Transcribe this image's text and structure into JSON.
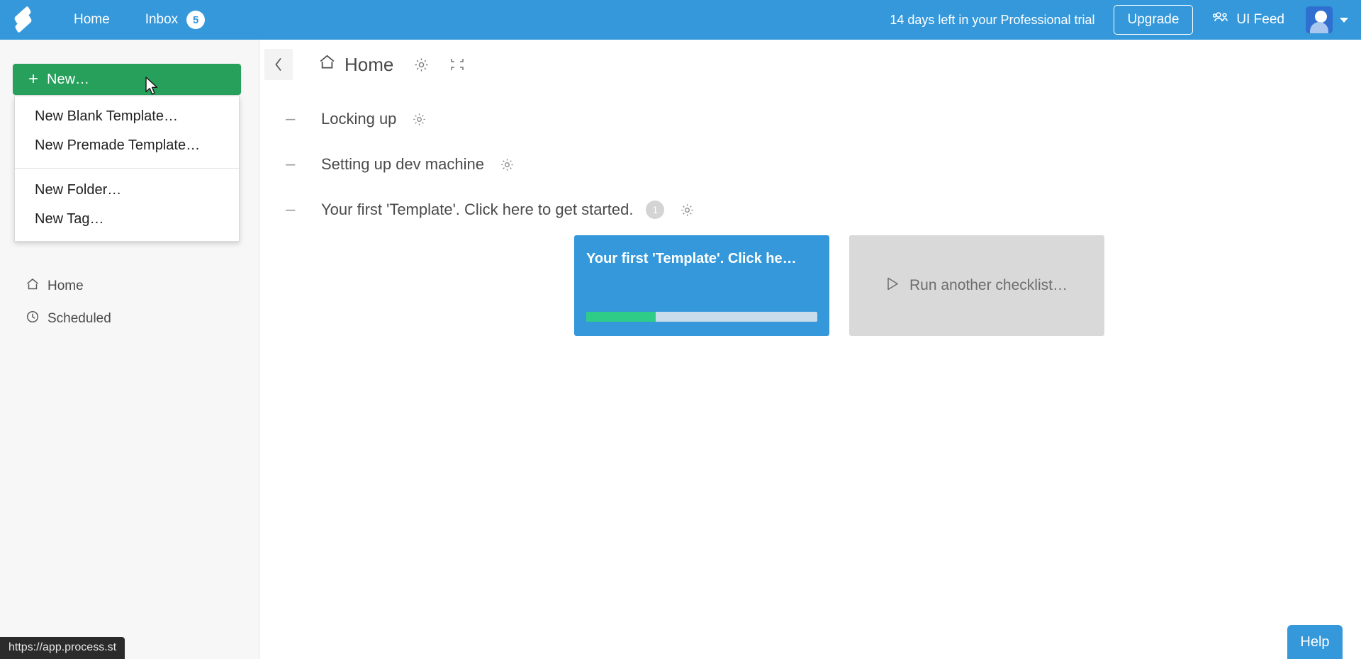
{
  "topbar": {
    "logo_icon": "process-street-logo-icon",
    "nav": [
      {
        "label": "Home",
        "name": "nav-home"
      },
      {
        "label": "Inbox",
        "name": "nav-inbox",
        "badge": "5"
      }
    ],
    "trial_text": "14 days left in your Professional trial",
    "upgrade_label": "Upgrade",
    "ui_feed_label": "UI Feed",
    "ui_feed_icon": "people-group-icon",
    "avatar_icon": "user-avatar",
    "caret_icon": "chevron-down-icon",
    "bg_color": "#3498db"
  },
  "sidebar": {
    "new_button_label": "New…",
    "new_button_color": "#27a05c",
    "dropdown": {
      "groups": [
        {
          "items": [
            {
              "label": "New Blank Template…",
              "name": "menu-new-blank-template"
            },
            {
              "label": "New Premade Template…",
              "name": "menu-new-premade-template"
            }
          ]
        },
        {
          "items": [
            {
              "label": "New Folder…",
              "name": "menu-new-folder"
            },
            {
              "label": "New Tag…",
              "name": "menu-new-tag"
            }
          ]
        }
      ]
    },
    "items": [
      {
        "label": "Home",
        "icon": "home-icon",
        "name": "sidebar-item-home"
      },
      {
        "label": "Scheduled",
        "icon": "clock-icon",
        "name": "sidebar-item-scheduled"
      }
    ]
  },
  "main": {
    "collapse_icon": "chevron-left-icon",
    "title": "Home",
    "title_icon": "home-icon",
    "header_actions": [
      {
        "icon": "gear-icon",
        "name": "page-settings-button"
      },
      {
        "icon": "collapse-all-icon",
        "name": "collapse-all-button"
      }
    ],
    "sections": [
      {
        "title": "Locking up",
        "toggle_icon": "minus-icon",
        "count": null,
        "gear_icon": "gear-icon",
        "cards": []
      },
      {
        "title": "Setting up dev machine",
        "toggle_icon": "minus-icon",
        "count": null,
        "gear_icon": "gear-icon",
        "cards": []
      },
      {
        "title": "Your first 'Template'. Click here to get started.",
        "toggle_icon": "minus-icon",
        "count": "1",
        "gear_icon": "gear-icon",
        "cards": [
          {
            "type": "checklist",
            "title": "Your first 'Template'. Click he…",
            "progress_percent": 30,
            "bg_color": "#3498db",
            "fill_color": "#2ecc86"
          },
          {
            "type": "placeholder",
            "label": "Run another checklist…",
            "icon": "play-triangle-icon",
            "bg_color": "#d9d9d9"
          }
        ]
      }
    ]
  },
  "status_bar": {
    "url": "https://app.process.st"
  },
  "help": {
    "label": "Help",
    "color": "#3498db"
  }
}
